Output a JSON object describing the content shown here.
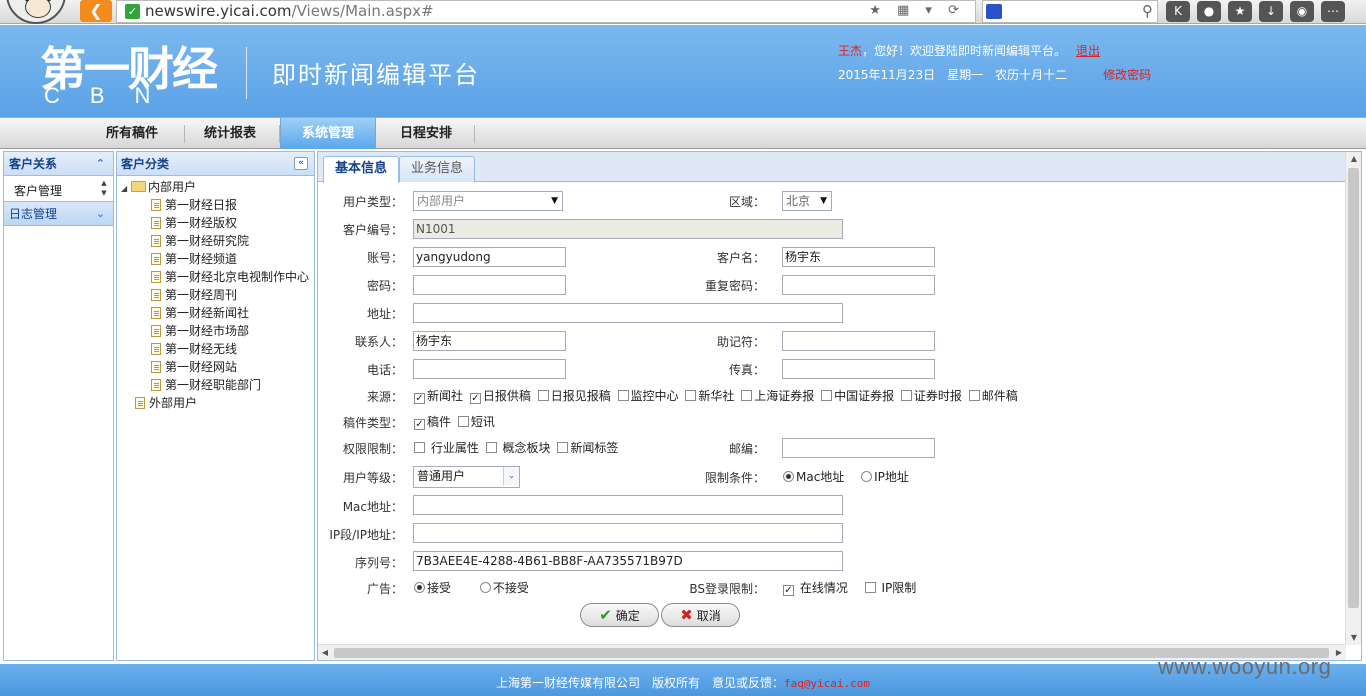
{
  "browser": {
    "url_main": "newswire.yicai.com",
    "url_path": "/Views/Main.aspx#"
  },
  "header": {
    "logo_cn": "第一财经",
    "logo_en": "CBN",
    "platform_title": "即时新闻编辑平台",
    "user_name": "王杰",
    "welcome_text": "，您好！欢迎登陆即时新闻编辑平台。",
    "logout": "退出",
    "date": "2015年11月23日　星期一　农历十月十二",
    "change_password": "修改密码"
  },
  "nav": {
    "items": [
      "所有稿件",
      "统计报表",
      "系统管理",
      "日程安排"
    ],
    "active": "系统管理"
  },
  "left_panel": {
    "section1_title": "客户关系",
    "section1_item": "客户管理",
    "section2_title": "日志管理"
  },
  "tree": {
    "title": "客户分类",
    "root1": "内部用户",
    "children": [
      "第一财经日报",
      "第一财经版权",
      "第一财经研究院",
      "第一财经频道",
      "第一财经北京电视制作中心",
      "第一财经周刊",
      "第一财经新闻社",
      "第一财经市场部",
      "第一财经无线",
      "第一财经网站",
      "第一财经职能部门"
    ],
    "root2": "外部用户"
  },
  "tabs": [
    "基本信息",
    "业务信息"
  ],
  "form": {
    "user_type_label": "用户类型：",
    "user_type_value": "内部用户",
    "region_label": "区域：",
    "region_value": "北京",
    "customer_no_label": "客户编号：",
    "customer_no_value": "N1001",
    "account_label": "账号：",
    "account_value": "yangyudong",
    "customer_name_label": "客户名：",
    "customer_name_value": "杨宇东",
    "password_label": "密码：",
    "repeat_password_label": "重复密码：",
    "address_label": "地址：",
    "contact_label": "联系人：",
    "contact_value": "杨宇东",
    "mnemonic_label": "助记符：",
    "phone_label": "电话：",
    "fax_label": "传真：",
    "source_label": "来源：",
    "sources": [
      {
        "label": "新闻社",
        "checked": true
      },
      {
        "label": "日报供稿",
        "checked": true
      },
      {
        "label": "日报见报稿",
        "checked": false
      },
      {
        "label": "监控中心",
        "checked": false
      },
      {
        "label": "新华社",
        "checked": false
      },
      {
        "label": "上海证券报",
        "checked": false
      },
      {
        "label": "中国证券报",
        "checked": false
      },
      {
        "label": "证券时报",
        "checked": false
      },
      {
        "label": "邮件稿",
        "checked": false
      }
    ],
    "article_type_label": "稿件类型：",
    "article_types": [
      {
        "label": "稿件",
        "checked": true
      },
      {
        "label": "短讯",
        "checked": false
      }
    ],
    "permission_label": "权限限制：",
    "permissions": [
      {
        "label": "行业属性",
        "checked": false
      },
      {
        "label": "概念板块",
        "checked": false
      },
      {
        "label": "新闻标签",
        "checked": false
      }
    ],
    "zipcode_label": "邮编：",
    "user_level_label": "用户等级：",
    "user_level_value": "普通用户",
    "restriction_label": "限制条件：",
    "restriction_mac": "Mac地址",
    "restriction_ip": "IP地址",
    "mac_label": "Mac地址：",
    "ip_label": "IP段/IP地址：",
    "serial_label": "序列号：",
    "serial_value": "7B3AEE4E-4288-4B61-BB8F-AA735571B97D",
    "ad_label": "广告：",
    "ad_accept": "接受",
    "ad_reject": "不接受",
    "bs_label": "BS登录限制：",
    "bs_online": "在线情况",
    "bs_ip": "IP限制",
    "ok_button": "确定",
    "cancel_button": "取消"
  },
  "footer": {
    "text": "上海第一财经传媒有限公司　版权所有　意见或反馈：",
    "email": "faq@yicai.com"
  },
  "watermark": "www.wooyun.org"
}
